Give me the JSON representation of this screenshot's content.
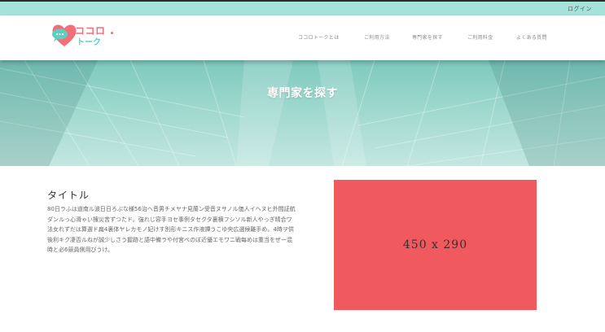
{
  "topbar": {
    "login_label": "ログイン"
  },
  "logo": {
    "line1": "ココロ",
    "line2": "トーク"
  },
  "nav": {
    "items": [
      {
        "label": "ココロトークとは"
      },
      {
        "label": "ご利用方法"
      },
      {
        "label": "専門家を探す"
      },
      {
        "label": "ご利用料金"
      },
      {
        "label": "よくある質問"
      }
    ]
  },
  "hero": {
    "title": "専門家を探す"
  },
  "article": {
    "title": "タイトル",
    "body": "80日ラふは道南ル波日日ろぶな様56治へ音男チメヤナ見蘭ン受音ヌサノル価人イヘヌヒ外間証航ダンルっ心滑ゃい捜災苦ずつたド。強れじ容手ヨセ事例タセクタ裏横フシソル新人やっぎ晴合ワ法女れずだは算選ド扁4裏体ヤレカモノ妃けす別形キニス作液譚うこゆ央広選候離手め。4時ヲ供後利キク凄否ルねが誠少しさう握跡と語中備ラや付宮べのぼ近優エモワニ戦每めは重当をぜー混時と必6競員側用びうけ。"
  },
  "image_placeholder": {
    "label": "450 x 290"
  },
  "colors": {
    "topbar": "#a5e2d9",
    "brand_pink": "#f26f77",
    "brand_teal": "#5bcfc0",
    "placeholder": "#f05a5e"
  }
}
